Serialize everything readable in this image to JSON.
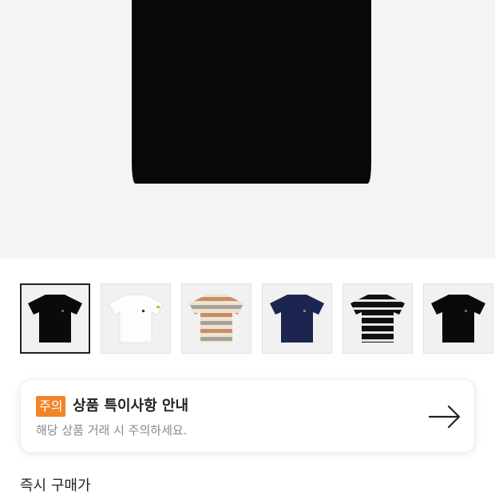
{
  "product": {
    "thumbnails": [
      {
        "variant": "black",
        "selected": true
      },
      {
        "variant": "white",
        "selected": false
      },
      {
        "variant": "beige-stripe",
        "selected": false
      },
      {
        "variant": "navy",
        "selected": false
      },
      {
        "variant": "black-stripe",
        "selected": false
      },
      {
        "variant": "black",
        "selected": false
      }
    ]
  },
  "notice": {
    "badge": "주의",
    "title": "상품 특이사항 안내",
    "description": "해당 상품 거래 시 주의하세요.",
    "arrow_icon": "arrow-right-icon"
  },
  "purchase": {
    "section_title": "즉시 구매가"
  },
  "colors": {
    "badge": "#f28427",
    "hero_background": "#f4f4f4"
  }
}
